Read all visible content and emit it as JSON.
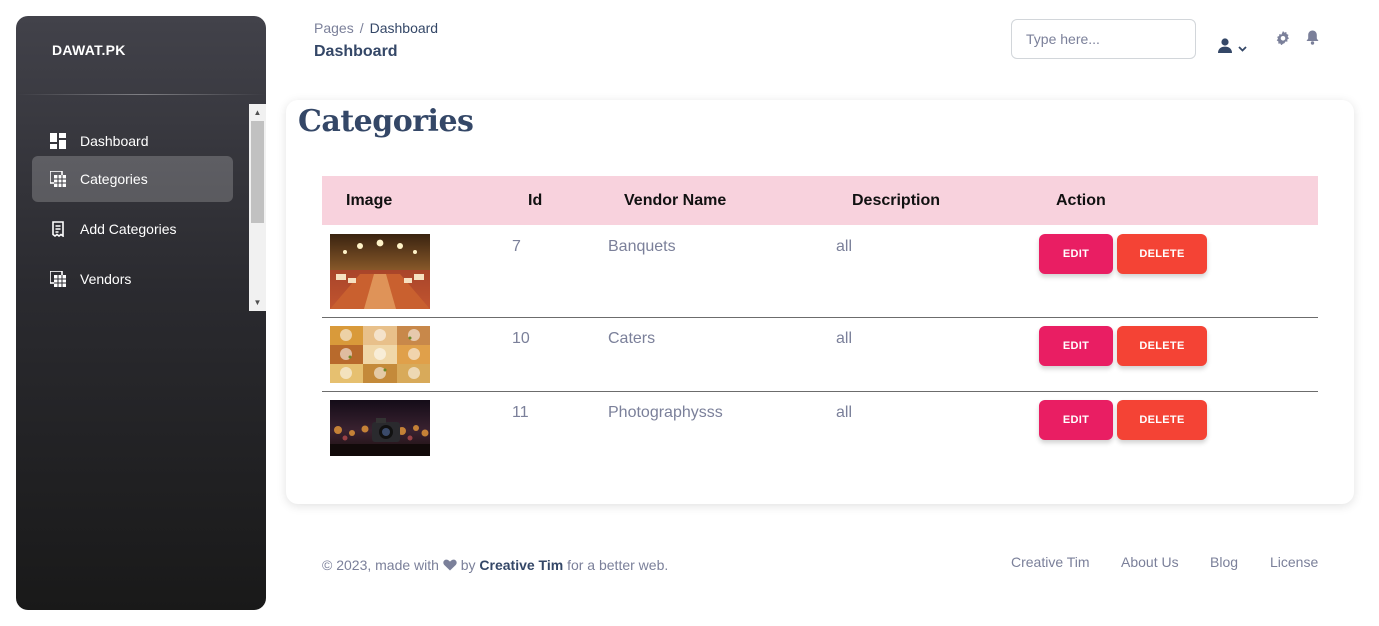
{
  "sidebar": {
    "brand": "DAWAT.PK",
    "items": [
      {
        "label": "Dashboard",
        "icon": "dashboard-icon"
      },
      {
        "label": "Categories",
        "icon": "table-icon",
        "active": true
      },
      {
        "label": "Add Categories",
        "icon": "receipt-icon"
      },
      {
        "label": "Vendors",
        "icon": "table-icon"
      }
    ]
  },
  "header": {
    "breadcrumb_root": "Pages",
    "breadcrumb_sep": "/",
    "breadcrumb_current": "Dashboard",
    "title": "Dashboard",
    "search_placeholder": "Type here...",
    "icons": [
      "user-icon",
      "chevron-down-icon",
      "gear-icon",
      "bell-icon"
    ]
  },
  "main": {
    "title": "Categories",
    "table": {
      "columns": [
        "Image",
        "Id",
        "Vendor Name",
        "Description",
        "Action"
      ],
      "rows": [
        {
          "id": "7",
          "vendor_name": "Banquets",
          "description": "all"
        },
        {
          "id": "10",
          "vendor_name": "Caters",
          "description": "all"
        },
        {
          "id": "11",
          "vendor_name": "Photographysss",
          "description": "all"
        }
      ],
      "edit_label": "EDIT",
      "delete_label": "DELETE"
    }
  },
  "footer": {
    "copyright_prefix": "© 2023, made with",
    "by": "by",
    "author": "Creative Tim",
    "suffix": "for a better web.",
    "links": [
      "Creative Tim",
      "About Us",
      "Blog",
      "License"
    ]
  },
  "colors": {
    "accent": "#e91e63",
    "danger": "#f44335",
    "table_header": "#f8d2dd",
    "heading": "#344767",
    "muted": "#7b809a"
  }
}
